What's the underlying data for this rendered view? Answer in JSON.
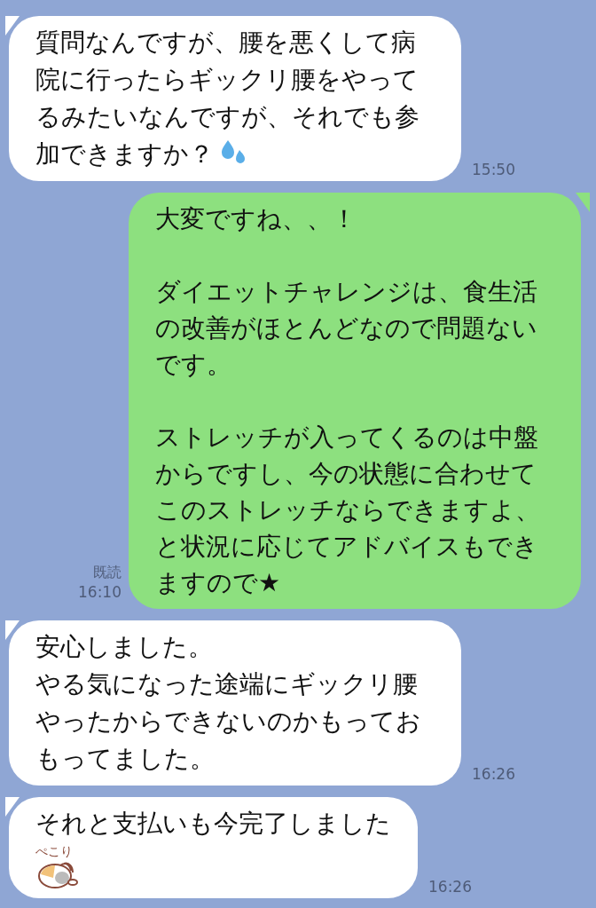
{
  "messages": [
    {
      "kind": "in",
      "paragraphs": [
        "質問なんですが、腰を悪くして病院に行ったらギックリ腰をやってるみたいなんですが、それでも参加できますか？"
      ],
      "has_emoji": true,
      "time": "15:50"
    },
    {
      "kind": "out",
      "spaced": true,
      "paragraphs": [
        "大変ですね、、！",
        "ダイエットチャレンジは、食生活の改善がほとんどなので問題ないです。",
        "ストレッチが入ってくるのは中盤からですし、今の状態に合わせてこのストレッチならできますよ、と状況に応じてアドバイスもできますので★"
      ],
      "has_emoji": false,
      "read_label": "既読",
      "time": "16:10"
    },
    {
      "kind": "in",
      "spaced": false,
      "paragraphs": [
        "安心しました。",
        "やる気になった途端にギックリ腰やったからできないのかもっておもってました。"
      ],
      "has_emoji": false,
      "time": "16:26"
    },
    {
      "kind": "in",
      "paragraphs": [
        "それと支払いも今完了しました"
      ],
      "has_emoji": false,
      "sticker": {
        "caption": "ぺこり"
      },
      "time": "16:26"
    }
  ]
}
